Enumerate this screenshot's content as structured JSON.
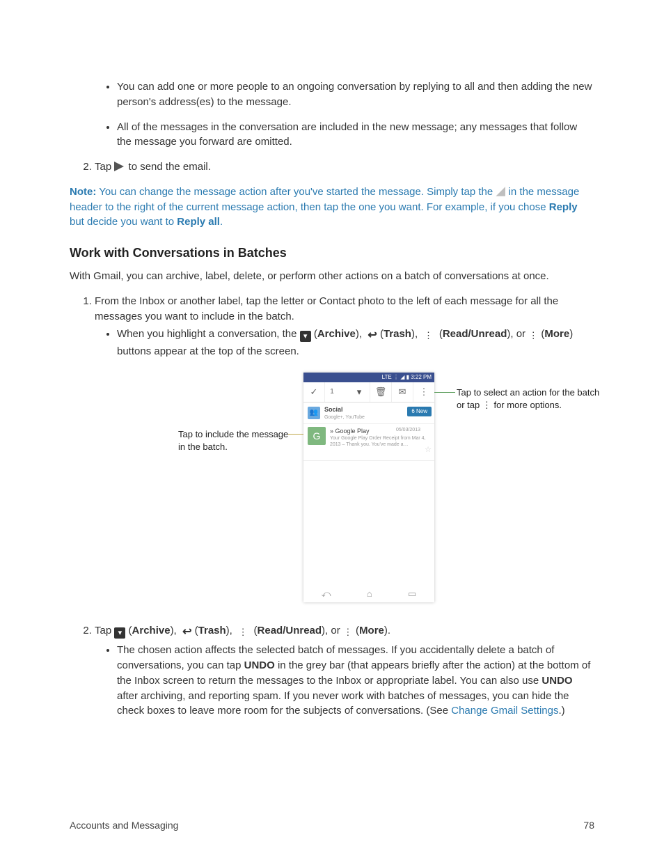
{
  "bullets_top": [
    "You can add one or more people to an ongoing conversation by replying to all and then adding the new person's address(es) to the message.",
    "All of the messages in the conversation are included in the new message; any messages that follow the message you forward are omitted."
  ],
  "step2_tap": "Tap ",
  "step2_tail": " to send the email.",
  "note": {
    "label": "Note:",
    "part1": " You can change the message action after you've started the message. Simply tap the ",
    "part2": " in the message header to the right of the current message action, then tap the one you want. For example, if you chose ",
    "reply": "Reply",
    "mid": " but decide you want to ",
    "replyall": "Reply all",
    "end": "."
  },
  "section_heading": "Work with Conversations in Batches",
  "section_para": "With Gmail, you can archive, label, delete, or perform other actions on a batch of conversations at once.",
  "batch_step1": "From the Inbox or another label, tap the letter or Contact photo to the left of each message for all the messages you want to include in the batch.",
  "batch_sub": {
    "lead": "When you highlight a conversation, the ",
    "archive": "Archive",
    "trash": "Trash",
    "readunread": "Read/Unread",
    "more": "More",
    "tail": " buttons appear at the top of the screen."
  },
  "callout_left": "Tap to include the message in the batch.",
  "callout_right_l1": "Tap to select an action for the batch",
  "callout_right_l2": "or tap ⋮ for more options.",
  "phone": {
    "status": "LTE ⋮ ◢ ▮ 3:22 PM",
    "count": "1",
    "social_title": "Social",
    "social_sub": "Google+, YouTube",
    "badge": "6 New",
    "msg_sender": "Google Play",
    "msg_snip": "Your Google Play Order Receipt from Mar 4, 2013 – Thank you. You've made a…",
    "msg_date": "05/03/2013"
  },
  "batch_step2": {
    "tap": "Tap ",
    "archive": "Archive",
    "trash": "Trash",
    "readunread": "Read/Unread",
    "or": ", or ",
    "more": "More",
    "end": "."
  },
  "batch_step2_sub_a": "The chosen action affects the selected batch of messages. If you accidentally delete a batch of conversations, you can tap ",
  "undo": "UNDO",
  "batch_step2_sub_b": " in the grey bar (that appears briefly after the action) at the bottom of the Inbox screen to return the messages to the Inbox or appropriate label. You can also use ",
  "batch_step2_sub_c": " after archiving, and reporting spam. If you never work with batches of messages, you can hide the check boxes to leave more room for the subjects of conversations. (See ",
  "link_text": "Change Gmail Settings",
  "batch_step2_sub_d": ".)",
  "footer_left": "Accounts and Messaging",
  "footer_right": "78"
}
